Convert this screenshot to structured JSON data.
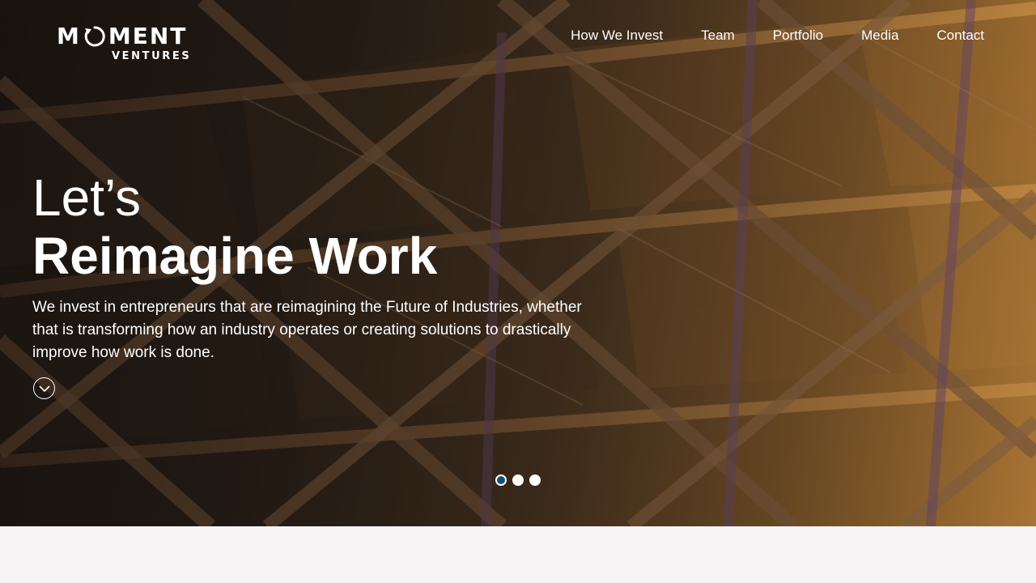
{
  "logo": {
    "primary_left": "M",
    "primary_right": "MENT",
    "secondary": "VENTURES",
    "icon": "circular-arrow-o-icon"
  },
  "nav": {
    "items": [
      {
        "label": "How We Invest"
      },
      {
        "label": "Team"
      },
      {
        "label": "Portfolio"
      },
      {
        "label": "Media"
      },
      {
        "label": "Contact"
      }
    ]
  },
  "hero": {
    "headline_line1": "Let’s",
    "headline_bold": "Reimagine",
    "headline_rest": " Work",
    "description": "We invest in entrepreneurs that are reimagining the Future of Industries, whether that is transforming how an industry operates or creating solutions to drastically improve how work is done.",
    "scroll_icon": "chevron-down-circle-icon",
    "background": "steel-roof-trusses-photo"
  },
  "carousel": {
    "slides": 3,
    "active_index": 0
  },
  "colors": {
    "page_bg": "#f6f4f5",
    "active_dot": "#1a4f73",
    "text": "#ffffff"
  }
}
